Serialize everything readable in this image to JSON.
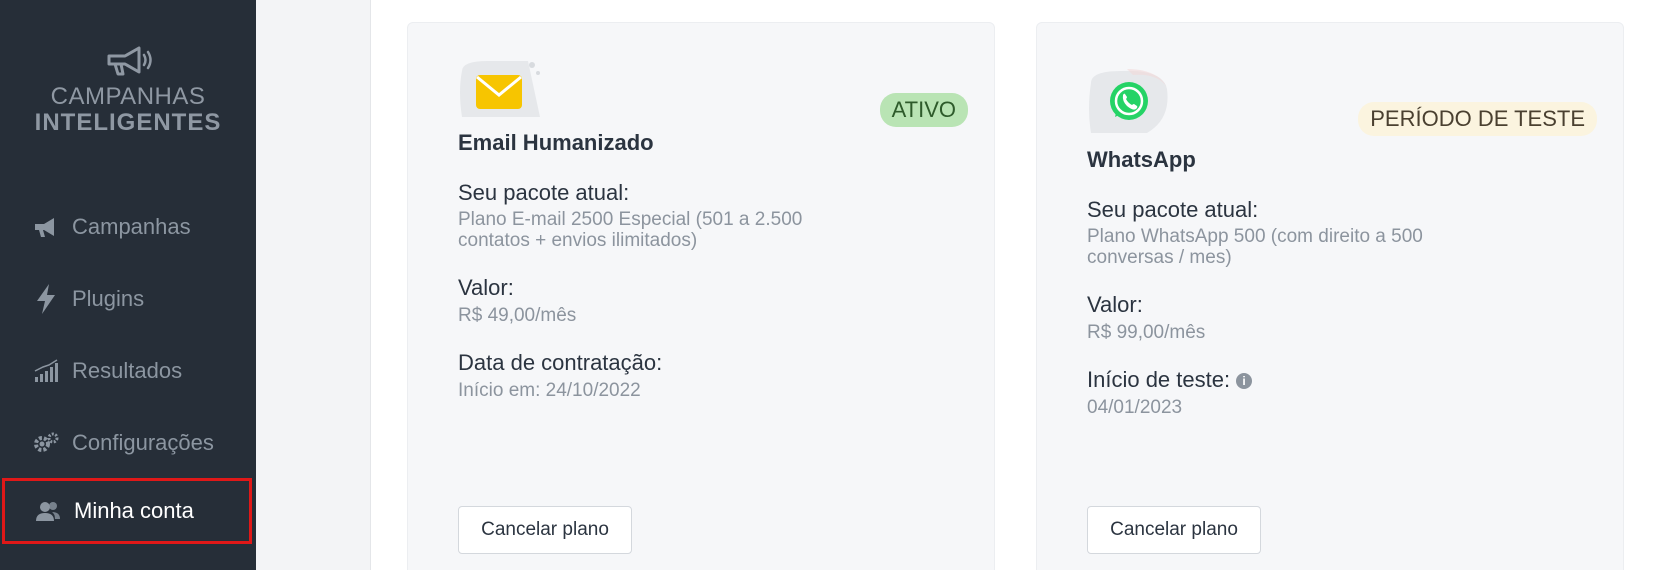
{
  "sidebar": {
    "logo": {
      "line1": "CAMPANHAS",
      "line2": "INTELIGENTES",
      "icon": "megaphone-icon"
    },
    "items": [
      {
        "label": "Campanhas",
        "icon": "megaphone-icon"
      },
      {
        "label": "Plugins",
        "icon": "lightning-icon"
      },
      {
        "label": "Resultados",
        "icon": "bar-chart-icon"
      },
      {
        "label": "Configurações",
        "icon": "gears-icon"
      },
      {
        "label": "Minha conta",
        "icon": "users-icon",
        "active": true
      }
    ]
  },
  "cards": [
    {
      "icon": "email-icon",
      "title": "Email Humanizado",
      "badge": "ATIVO",
      "package_label": "Seu pacote atual:",
      "package_value": "Plano E-mail 2500 Especial (501 a 2.500 contatos + envios ilimitados)",
      "price_label": "Valor:",
      "price_value": "R$ 49,00/mês",
      "date_label": "Data de contratação:",
      "date_value": "Início em: 24/10/2022",
      "cancel_label": "Cancelar plano"
    },
    {
      "icon": "whatsapp-icon",
      "title": "WhatsApp",
      "badge": "PERÍODO DE TESTE",
      "package_label": "Seu pacote atual:",
      "package_value": "Plano WhatsApp 500 (com direito a 500 conversas / mes)",
      "price_label": "Valor:",
      "price_value": "R$ 99,00/mês",
      "date_label": "Início de teste:",
      "date_value": "04/01/2023",
      "cancel_label": "Cancelar plano"
    }
  ],
  "colors": {
    "sidebar_bg": "#262e38",
    "active_outline": "#e01818",
    "badge_ativo_bg": "#b9e4b4",
    "badge_teste_bg": "#fbf4df",
    "email_icon": "#f7c500",
    "whatsapp_icon": "#25d366"
  }
}
